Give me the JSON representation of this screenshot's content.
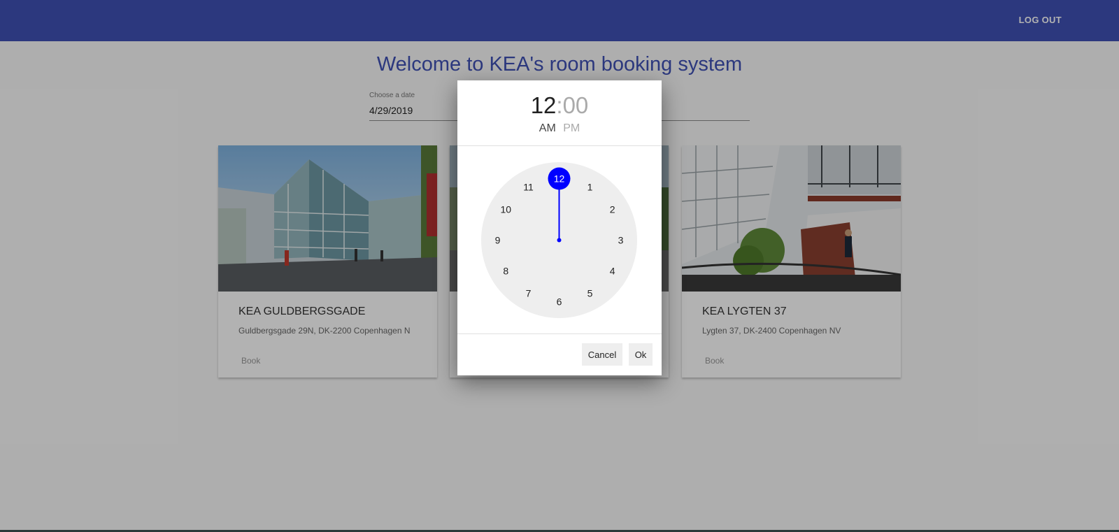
{
  "appbar": {
    "logout_label": "LOG OUT"
  },
  "page": {
    "title": "Welcome to KEA's room booking system"
  },
  "date_picker": {
    "label": "Choose a date",
    "value": "4/29/2019"
  },
  "cards": [
    {
      "title": "KEA GULDBERGSGADE",
      "address": "Guldbergsgade 29N, DK-2200 Copenhagen N",
      "book_label": "Book"
    },
    {
      "title": "",
      "address": "",
      "book_label": ""
    },
    {
      "title": "KEA LYGTEN 37",
      "address": "Lygten 37, DK-2400 Copenhagen NV",
      "book_label": "Book"
    }
  ],
  "time_picker": {
    "hour": "12",
    "separator": ":",
    "minutes": "00",
    "am_label": "AM",
    "pm_label": "PM",
    "selected_hour": 12,
    "clock_numbers": [
      "12",
      "1",
      "2",
      "3",
      "4",
      "5",
      "6",
      "7",
      "8",
      "9",
      "10",
      "11"
    ],
    "cancel_label": "Cancel",
    "ok_label": "Ok"
  },
  "colors": {
    "primary": "#3f51b5",
    "selected": "#0000ff",
    "clock_face": "#eeeeee"
  }
}
